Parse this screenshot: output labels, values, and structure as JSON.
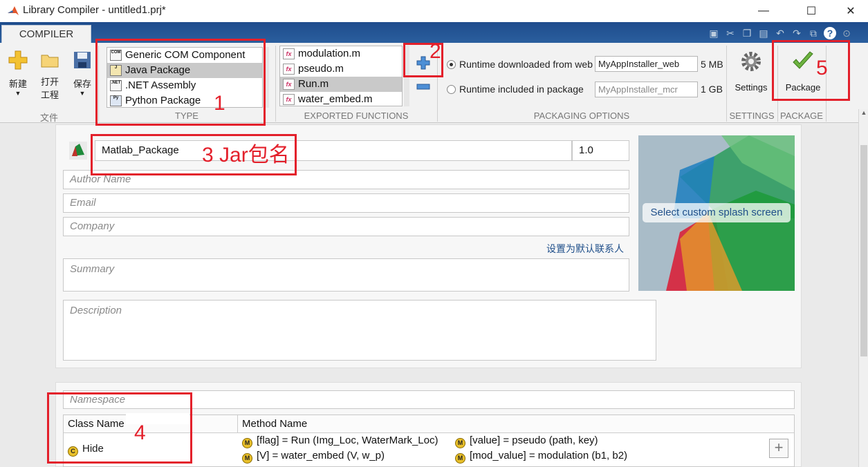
{
  "window": {
    "title": "Library Compiler - untitled1.prj*",
    "controls": {
      "minimize": "—",
      "maximize": "☐",
      "close": "✕"
    }
  },
  "ribbon": {
    "tab": "COMPILER",
    "file_group": {
      "label": "文件",
      "new_label": "新建",
      "open_label_line1": "打开",
      "open_label_line2": "工程",
      "save_label": "保存"
    },
    "type_group": {
      "label": "TYPE",
      "items": [
        {
          "label": "Generic COM Component",
          "icon": "com-icon",
          "selected": false
        },
        {
          "label": "Java Package",
          "icon": "java-icon",
          "selected": true
        },
        {
          "label": ".NET Assembly",
          "icon": "net-icon",
          "selected": false
        },
        {
          "label": "Python Package",
          "icon": "python-icon",
          "selected": false
        }
      ]
    },
    "exported_functions": {
      "label": "EXPORTED FUNCTIONS",
      "items": [
        {
          "label": "modulation.m",
          "selected": false
        },
        {
          "label": "pseudo.m",
          "selected": false
        },
        {
          "label": "Run.m",
          "selected": true
        },
        {
          "label": "water_embed.m",
          "selected": false
        }
      ],
      "add_icon": "plus-icon",
      "remove_icon": "minus-icon"
    },
    "packaging_options": {
      "label": "PACKAGING OPTIONS",
      "web": {
        "label": "Runtime downloaded from web",
        "value": "MyAppInstaller_web",
        "size": "5 MB",
        "selected": true
      },
      "mcr": {
        "label": "Runtime included in package",
        "value": "MyAppInstaller_mcr",
        "size": "1 GB",
        "selected": false
      }
    },
    "settings": {
      "label": "SETTINGS",
      "button": "Settings"
    },
    "package": {
      "label": "PACKAGE",
      "button": "Package"
    }
  },
  "form": {
    "package_name": "Matlab_Package",
    "version": "1.0",
    "author_placeholder": "Author Name",
    "email_placeholder": "Email",
    "company_placeholder": "Company",
    "default_contact_link": "设置为默认联系人",
    "summary_placeholder": "Summary",
    "description_placeholder": "Description",
    "splash_label": "Select custom splash screen"
  },
  "classes": {
    "namespace_placeholder": "Namespace",
    "col_class": "Class Name",
    "col_method": "Method Name",
    "class_name": "Hide",
    "methods": [
      "[flag] = Run (Img_Loc, WaterMark_Loc)",
      "[value] = pseudo (path, key)",
      "[V] = water_embed (V, w_p)",
      "[mod_value] = modulation (b1, b2)"
    ],
    "add_class_icon": "plus-icon"
  },
  "annotations": {
    "n1": "1",
    "n2": "2",
    "n3": "3 Jar包名",
    "n4": "4",
    "n5": "5",
    "color": "#e3202b"
  }
}
